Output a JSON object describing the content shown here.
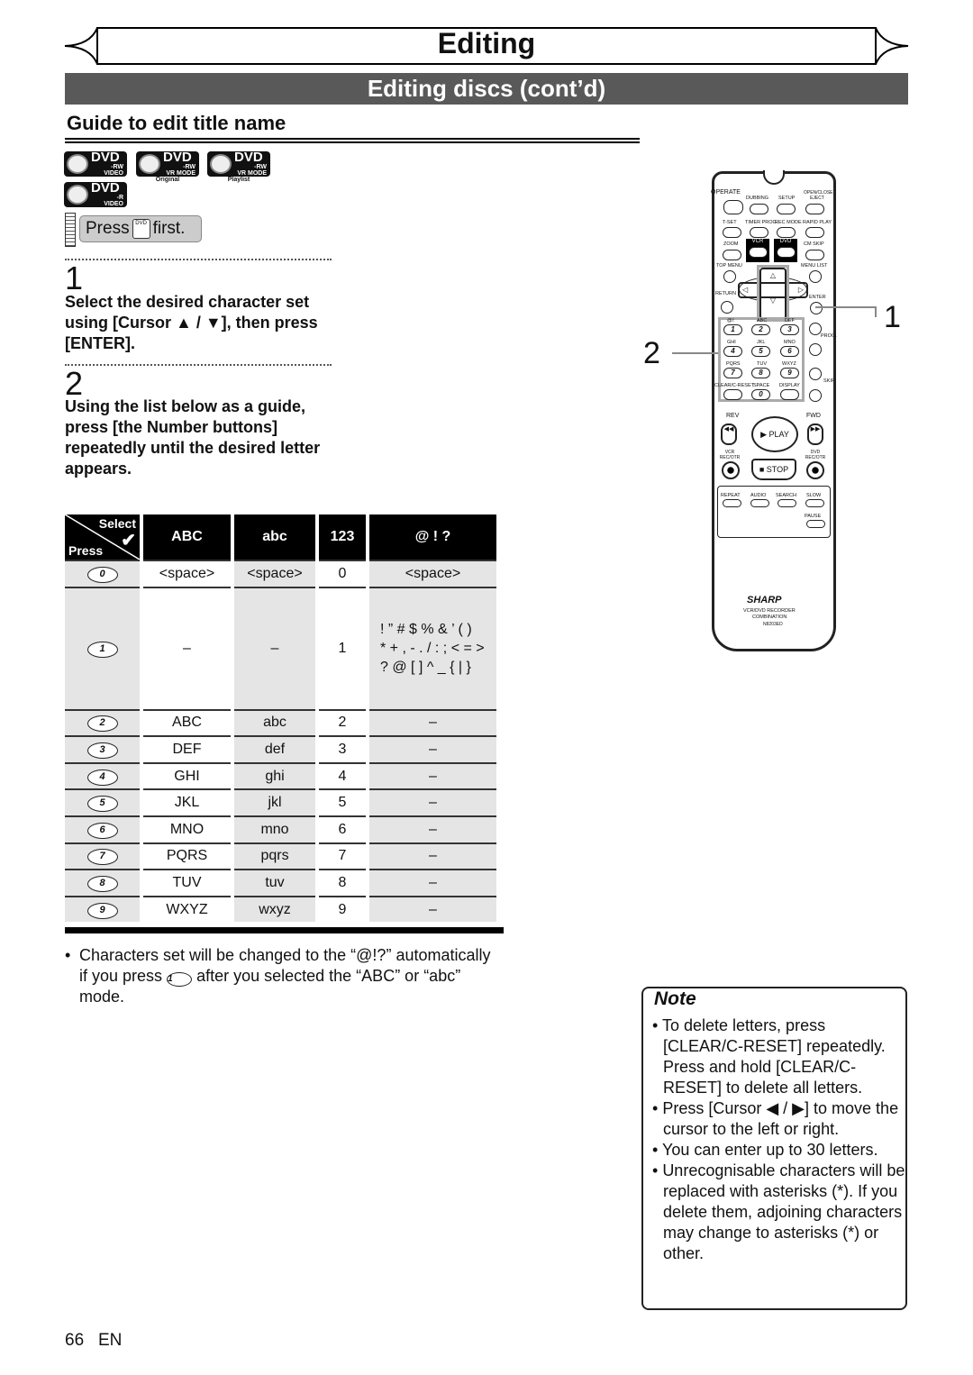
{
  "header": {
    "section_title": "Editing",
    "bar_title": "Editing discs (cont’d)",
    "subtitle": "Guide to edit title name"
  },
  "disc_icons": [
    {
      "label": "DVD",
      "type": "-RW",
      "mode": "VIDEO MODE",
      "caption": ""
    },
    {
      "label": "DVD",
      "type": "-RW",
      "mode": "VR MODE",
      "caption": "Original"
    },
    {
      "label": "DVD",
      "type": "-RW",
      "mode": "VR MODE",
      "caption": "Playlist"
    },
    {
      "label": "DVD",
      "type": "-R",
      "mode": "VIDEO MODE",
      "caption": ""
    }
  ],
  "press_first": {
    "press": "Press",
    "key": "DVD",
    "first": "first."
  },
  "steps": [
    {
      "number": "1",
      "text": "Select the desired character set using [Cursor ▲ / ▼], then press [ENTER]."
    },
    {
      "number": "2",
      "text": "Using the list below as a guide, press [the Number buttons] repeatedly until the desired letter appears."
    }
  ],
  "table": {
    "corner_top": "Select",
    "corner_bottom": "Press",
    "headers": [
      "ABC",
      "abc",
      "123",
      "@ ! ?"
    ],
    "rows": [
      {
        "key": "0",
        "cells": [
          "<space>",
          "<space>",
          "0",
          "<space>"
        ]
      },
      {
        "key": "1",
        "cells": [
          "–",
          "–",
          "1",
          "! ” # $ % & ’ ( )"
        ],
        "extra": [
          "* + , - . / : ; < = >",
          "? @ [ ] ^ _ { | }"
        ]
      },
      {
        "key": "2",
        "cells": [
          "ABC",
          "abc",
          "2",
          "–"
        ]
      },
      {
        "key": "3",
        "cells": [
          "DEF",
          "def",
          "3",
          "–"
        ]
      },
      {
        "key": "4",
        "cells": [
          "GHI",
          "ghi",
          "4",
          "–"
        ]
      },
      {
        "key": "5",
        "cells": [
          "JKL",
          "jkl",
          "5",
          "–"
        ]
      },
      {
        "key": "6",
        "cells": [
          "MNO",
          "mno",
          "6",
          "–"
        ]
      },
      {
        "key": "7",
        "cells": [
          "PQRS",
          "pqrs",
          "7",
          "–"
        ]
      },
      {
        "key": "8",
        "cells": [
          "TUV",
          "tuv",
          "8",
          "–"
        ]
      },
      {
        "key": "9",
        "cells": [
          "WXYZ",
          "wxyz",
          "9",
          "–"
        ]
      }
    ]
  },
  "bullet": {
    "before": "Characters set will be changed to the “@!?” automatically if you press",
    "key": "1",
    "after": "after you selected the “ABC” or “abc” mode."
  },
  "note": {
    "title": "Note",
    "items": [
      "To delete letters, press [CLEAR/C-RESET] repeatedly. Press and hold [CLEAR/C-RESET] to delete all letters.",
      "Press [Cursor ◀ / ▶] to move the cursor to the left or right.",
      "You can enter up to 30 letters.",
      "Unrecognisable characters will be replaced with asterisks (*). If you delete them, adjoining characters may change to asterisks (*) or other."
    ]
  },
  "remote": {
    "operate": "OPERATE",
    "dubbing": "DUBBING",
    "setup": "SETUP",
    "eject": "OPEN/CLOSE EJECT",
    "tset": "T-SET",
    "timer": "TIMER PROG.",
    "recmode": "REC MODE",
    "rapid": "RAPID PLAY",
    "zoom": "ZOOM",
    "vcr": "VCR",
    "dvd": "DVD",
    "cmskip": "CM SKIP",
    "topmenu": "TOP MENU",
    "menulist": "MENU LIST",
    "return": "RETURN",
    "enter": "ENTER",
    "num_labels": [
      "@/:",
      "ABC",
      "DEF",
      "GHI",
      "JKL",
      "MNO",
      "PQRS",
      "TUV",
      "WXYZ"
    ],
    "num_keys": [
      "1",
      "2",
      "3",
      "4",
      "5",
      "6",
      "7",
      "8",
      "9",
      "0"
    ],
    "prog": "PROG.",
    "skip": "SKIP",
    "clear": "CLEAR/C-RESET",
    "space": "SPACE",
    "display": "DISPLAY",
    "rev": "REV",
    "fwd": "FWD",
    "play": "▶ PLAY",
    "vcr_rec": "VCR REC/OTR",
    "dvd_rec": "DVD REC/OTR",
    "stop": "■ STOP",
    "repeat": "REPEAT",
    "audio": "AUDIO",
    "search": "SEARCH",
    "slow": "SLOW",
    "pause": "PAUSE",
    "brand": "SHARP",
    "model1": "VCR/DVD RECORDER",
    "model2": "COMBINATION",
    "model3": "N8203ED",
    "callout1": "1",
    "callout2": "2"
  },
  "footer": {
    "page": "66",
    "lang": "EN"
  }
}
